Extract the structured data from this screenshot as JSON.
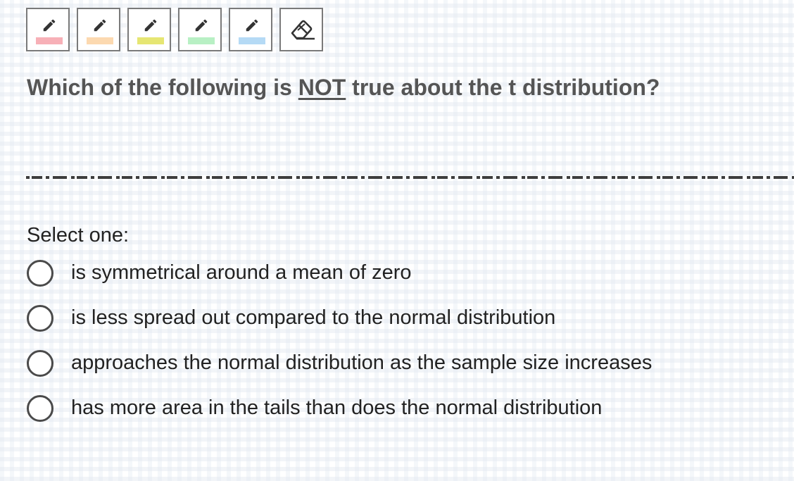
{
  "toolbar": {
    "tools": [
      {
        "icon": "pencil-icon",
        "color": "#f7b0b7"
      },
      {
        "icon": "pencil-icon",
        "color": "#fcd9b0"
      },
      {
        "icon": "pencil-icon",
        "color": "#e6e673"
      },
      {
        "icon": "pencil-icon",
        "color": "#b8f0c4"
      },
      {
        "icon": "pencil-icon",
        "color": "#b5daf5"
      },
      {
        "icon": "eraser-icon"
      }
    ]
  },
  "question": {
    "prefix": "Which of the following is ",
    "emphasis": "NOT",
    "suffix": " true about the t distribution?"
  },
  "prompt": "Select one:",
  "options": [
    {
      "label": "is symmetrical around a mean of zero",
      "selected": false
    },
    {
      "label": "is less spread out compared to the normal distribution",
      "selected": false
    },
    {
      "label": "approaches the normal distribution as the sample size increases",
      "selected": false
    },
    {
      "label": "has more area in the tails than does the normal distribution",
      "selected": false
    }
  ]
}
